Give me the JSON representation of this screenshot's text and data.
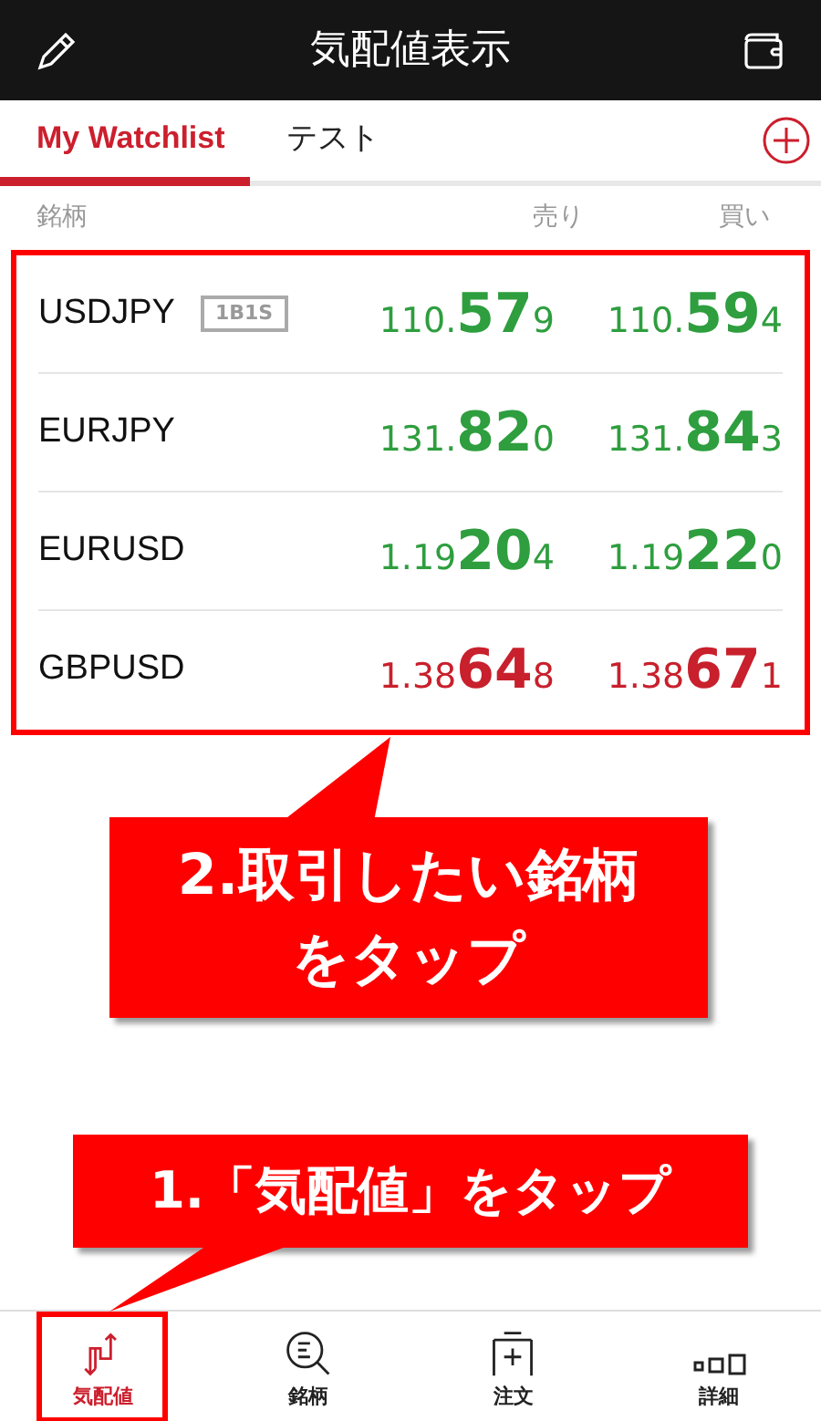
{
  "header": {
    "title": "気配値表示"
  },
  "tabs": [
    {
      "label": "My Watchlist",
      "selected": true
    },
    {
      "label": "テスト",
      "selected": false
    }
  ],
  "columns": [
    "銘柄",
    "売り",
    "買い"
  ],
  "rows": [
    {
      "symbol": "USDJPY",
      "badge": "1B1S",
      "color": "#2e9e3e",
      "bid": [
        "110.",
        "57",
        "9"
      ],
      "ask": [
        "110.",
        "59",
        "4"
      ]
    },
    {
      "symbol": "EURJPY",
      "color": "#2e9e3e",
      "bid": [
        "131.",
        "82",
        "0"
      ],
      "ask": [
        "131.",
        "84",
        "3"
      ]
    },
    {
      "symbol": "EURUSD",
      "color": "#2e9e3e",
      "bid": [
        "1.19",
        "20",
        "4"
      ],
      "ask": [
        "1.19",
        "22",
        "0"
      ]
    },
    {
      "symbol": "GBPUSD",
      "color": "#c8202c",
      "bid": [
        "1.38",
        "64",
        "8"
      ],
      "ask": [
        "1.38",
        "67",
        "1"
      ]
    }
  ],
  "callouts": [
    "2.取引したい銘柄をタップ",
    "1.「気配値」をタップ"
  ],
  "nav": [
    {
      "label": "気配値",
      "selected": true,
      "kind": "quotes"
    },
    {
      "label": "銘柄",
      "selected": false,
      "kind": "search"
    },
    {
      "label": "注文",
      "selected": false,
      "kind": "order"
    },
    {
      "label": "詳細",
      "selected": false,
      "kind": "detail"
    }
  ]
}
